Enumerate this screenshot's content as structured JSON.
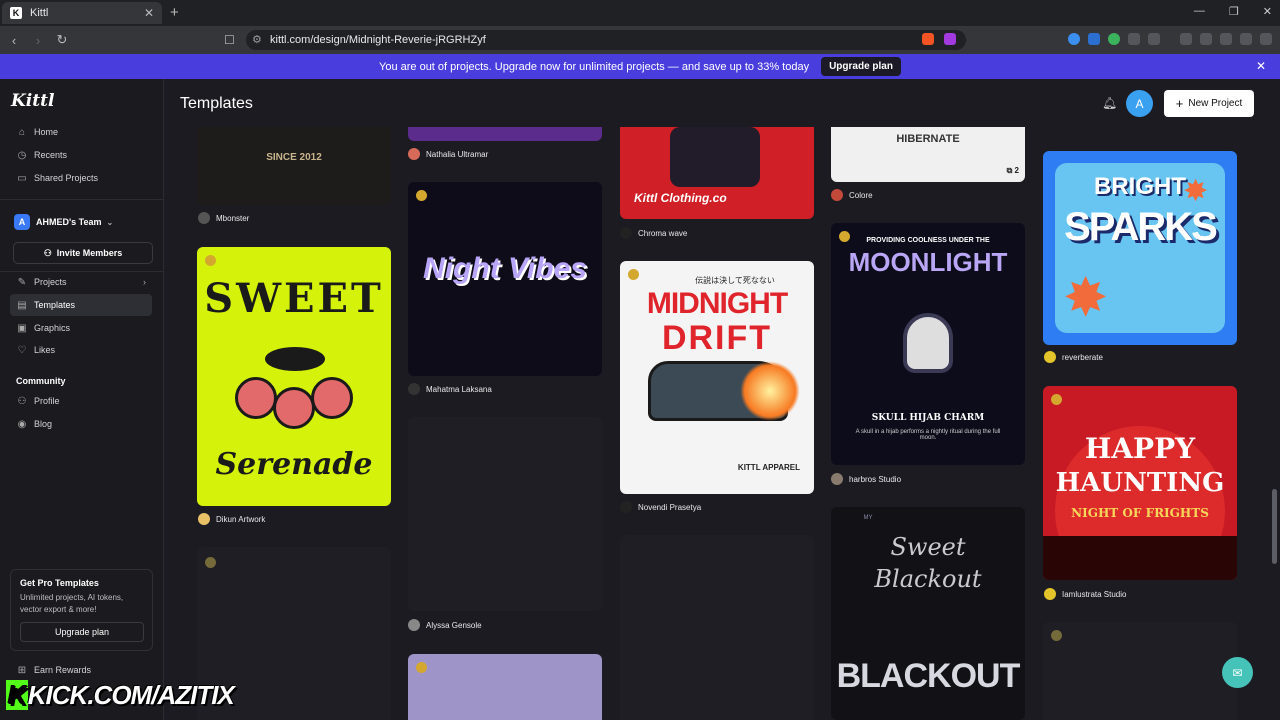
{
  "browser": {
    "tab_title": "Kittl",
    "url": "kittl.com/design/Midnight-Reverie-jRGRHZyf"
  },
  "banner": {
    "message": "You are out of projects. Upgrade now for unlimited projects — and save up to 33% today",
    "button": "Upgrade plan"
  },
  "sidebar": {
    "logo": "Kittl",
    "top_items": [
      {
        "label": "Home",
        "icon": "home-icon"
      },
      {
        "label": "Recents",
        "icon": "clock-icon"
      },
      {
        "label": "Shared Projects",
        "icon": "folder-icon"
      }
    ],
    "team": {
      "initial": "A",
      "name": "AHMED's Team"
    },
    "invite": "Invite Members",
    "items": [
      {
        "label": "Projects",
        "icon": "projects-icon"
      },
      {
        "label": "Templates",
        "icon": "templates-icon"
      },
      {
        "label": "Graphics",
        "icon": "graphics-icon"
      },
      {
        "label": "Likes",
        "icon": "heart-icon"
      }
    ],
    "community_label": "Community",
    "community_items": [
      {
        "label": "Profile",
        "icon": "person-icon"
      },
      {
        "label": "Blog",
        "icon": "rss-icon"
      }
    ],
    "pro": {
      "title": "Get Pro Templates",
      "desc": "Unlimited projects, AI tokens, vector export & more!",
      "button": "Upgrade plan"
    },
    "earn": "Earn Rewards"
  },
  "header": {
    "title": "Templates",
    "avatar_initial": "A",
    "new_project": "New Project"
  },
  "templates": {
    "col1": [
      {
        "author": "Mbonster"
      },
      {
        "author": "Dikun Artwork",
        "poster_top": "SWEET",
        "poster_bottom": "Serenade"
      }
    ],
    "col2": [
      {
        "author": "Nathalia Ultramar"
      },
      {
        "author": "Mahatma Laksana",
        "poster": "Night Vibes"
      },
      {
        "author": "Alyssa Gensole"
      }
    ],
    "col3": [
      {
        "author": "Chroma wave",
        "poster": "Kittl Clothing.co"
      },
      {
        "author": "Novendi Prasetya",
        "poster_jp": "伝説は決して死なない",
        "poster_a": "MIDNIGHT",
        "poster_b": "DRIFT",
        "poster_c": "KITTL APPAREL"
      }
    ],
    "col4": [
      {
        "author": "Colore",
        "poster": "HIBERNATE",
        "count": "2"
      },
      {
        "author": "harbros Studio",
        "poster_top": "PROVIDING COOLNESS UNDER THE",
        "poster": "MOONLIGHT",
        "poster_sub": "SKULL HIJAB CHARM",
        "poster_caption": "A skull in a hijab performs a nightly ritual during the full moon."
      },
      {
        "poster_a": "Sweet",
        "poster_b": "Blackout",
        "poster_c": "BLACKOUT",
        "poster_d": "MY"
      }
    ],
    "col5": [
      {
        "author": "reverberate",
        "poster_a": "BRIGHT",
        "poster_b": "SPARKS"
      },
      {
        "author": "Iamlustrata Studio",
        "poster_a": "HAPPY",
        "poster_b": "HAUNTING",
        "poster_c": "NIGHT OF FRIGHTS"
      }
    ]
  },
  "watermark": {
    "k": "K",
    "text": "KICK.COM/AZITIX"
  }
}
